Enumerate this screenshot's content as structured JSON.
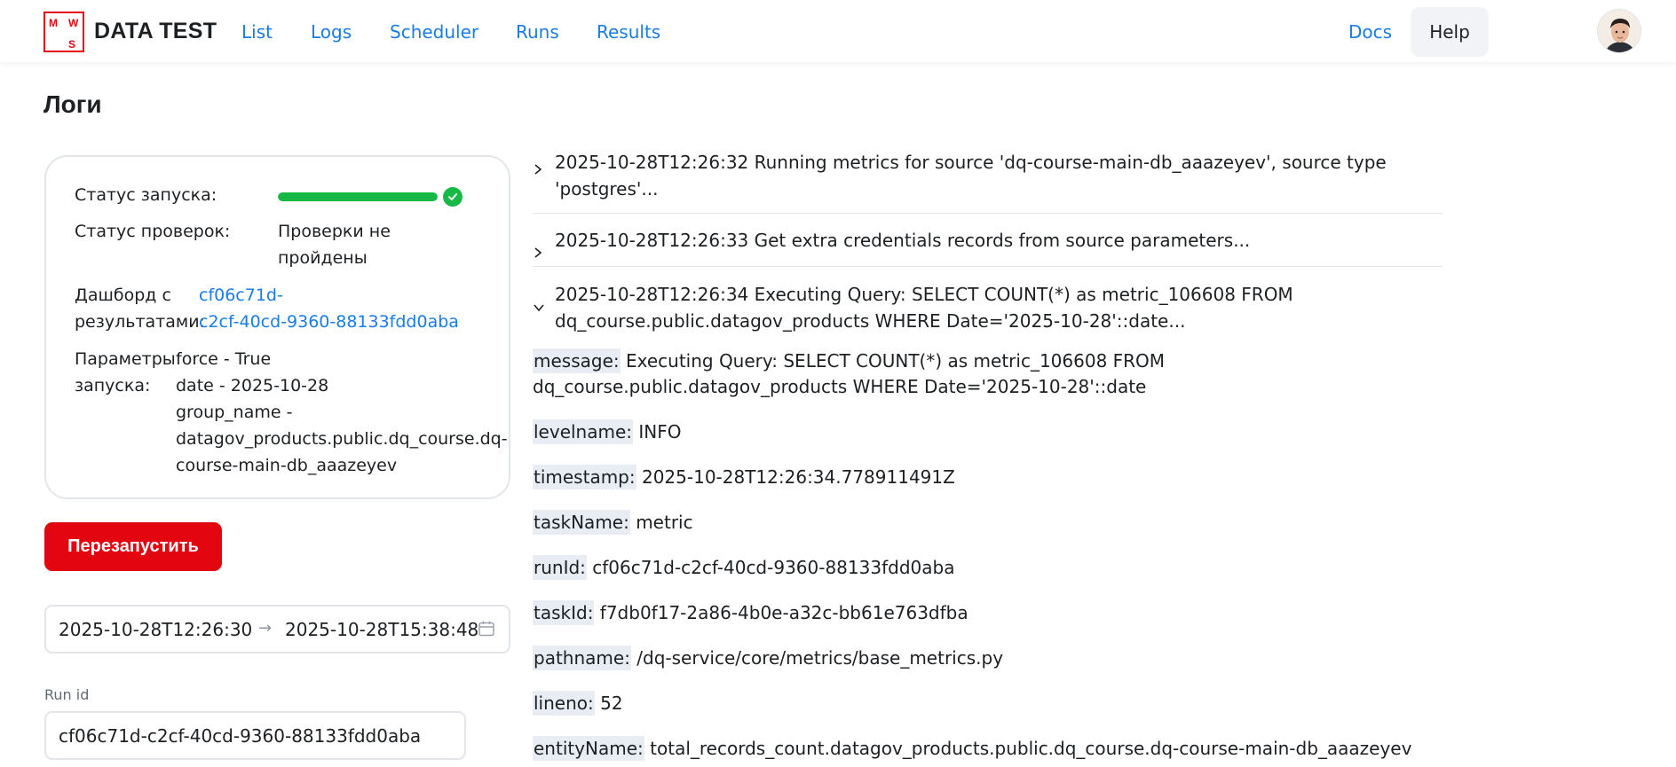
{
  "header": {
    "logo": {
      "m": "M",
      "w": "W",
      "s": "S"
    },
    "brand": "DATA TEST",
    "nav": [
      "List",
      "Logs",
      "Scheduler",
      "Runs",
      "Results"
    ],
    "docs": "Docs",
    "help": "Help"
  },
  "page": {
    "title": "Логи"
  },
  "status": {
    "run_status_label": "Статус запуска:",
    "run_progress": 1.0,
    "checks_label": "Статус проверок:",
    "checks_value_line1": "Проверки не",
    "checks_value_line2": "пройдены",
    "dashboard_label_line1": "Дашборд с",
    "dashboard_label_line2": "результатами:",
    "dashboard_link_line1": "cf06c71d-",
    "dashboard_link_line2": "c2cf-40cd-9360-88133fdd0aba",
    "params_label_line1": "Параметры",
    "params_label_line2": "запуска:",
    "params": [
      "force - True",
      "date - 2025-10-28",
      "group_name -",
      "datagov_products.public.dq_course.dq-",
      "course-main-db_aaazeyev"
    ]
  },
  "actions": {
    "restart": "Перезапустить"
  },
  "filters": {
    "date_from": "2025-10-28T12:26:30",
    "date_to": "2025-10-28T15:38:48",
    "arrow": "→",
    "run_id_label": "Run id",
    "run_id_value": "cf06c71d-c2cf-40cd-9360-88133fdd0aba"
  },
  "logs": [
    {
      "expanded": false,
      "line1": "2025-10-28T12:26:32 Running metrics for source 'dq-course-main-db_aaazeyev', source type",
      "line2": "'postgres'..."
    },
    {
      "expanded": false,
      "line1": "2025-10-28T12:26:33 Get extra credentials records from source parameters..."
    },
    {
      "expanded": true,
      "line1": "2025-10-28T12:26:34 Executing Query: SELECT COUNT(*) as metric_106608 FROM",
      "line2": "dq_course.public.datagov_products WHERE Date='2025-10-28'::date..."
    }
  ],
  "details": [
    {
      "key": "message:",
      "value": " Executing Query: SELECT COUNT(*) as metric_106608 FROM",
      "value2": "dq_course.public.datagov_products WHERE Date='2025-10-28'::date"
    },
    {
      "key": "levelname:",
      "value": " INFO"
    },
    {
      "key": "timestamp:",
      "value": " 2025-10-28T12:26:34.778911491Z"
    },
    {
      "key": "taskName:",
      "value": " metric"
    },
    {
      "key": "runId:",
      "value": " cf06c71d-c2cf-40cd-9360-88133fdd0aba"
    },
    {
      "key": "taskId:",
      "value": " f7db0f17-2a86-4b0e-a32c-bb61e763dfba"
    },
    {
      "key": "pathname:",
      "value": " /dq-service/core/metrics/base_metrics.py"
    },
    {
      "key": "lineno:",
      "value": " 52"
    },
    {
      "key": "entityName:",
      "value": " total_records_count.datagov_products.public.dq_course.dq-course-main-db_aaazeyev"
    }
  ],
  "colors": {
    "brand_red": "#e30611",
    "link_blue": "#1a7ce6",
    "success_green": "#16b946",
    "key_bg": "#e8ecf3"
  },
  "icons": {
    "chevron_collapsed": "chevron-right-icon",
    "chevron_expanded": "chevron-down-icon",
    "calendar": "calendar-icon",
    "check": "check-circle-icon"
  }
}
